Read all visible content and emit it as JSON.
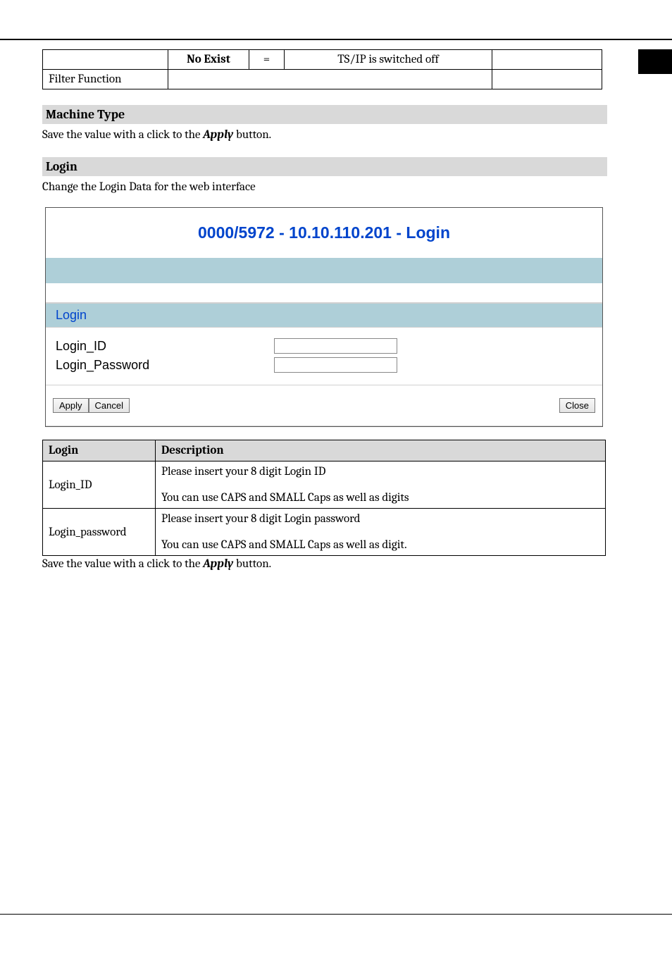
{
  "top_table": {
    "row1": {
      "c1": "",
      "c2": "No Exist",
      "c3": "=",
      "c4": "TS/IP is switched off",
      "c5": ""
    },
    "row2": {
      "c1": "Filter Function",
      "c2": "",
      "c3": "",
      "c4": "",
      "c5": ""
    }
  },
  "section_machine_type": {
    "heading": "Machine Type",
    "text_prefix": "Save the value with a click to the ",
    "text_bold": "Apply",
    "text_suffix": " button."
  },
  "section_login": {
    "heading": "Login",
    "text": "Change the Login Data for the web interface"
  },
  "login_panel": {
    "title": "0000/5972 - 10.10.110.201 - Login",
    "section_label": "Login",
    "field1_label": "Login_ID",
    "field1_value": "",
    "field2_label": "Login_Password",
    "field2_value": "",
    "buttons": {
      "apply": "Apply",
      "cancel": "Cancel",
      "close": "Close"
    }
  },
  "desc_table": {
    "header": {
      "c1": "Login",
      "c2": "Description"
    },
    "rows": [
      {
        "c1": "Login_ID",
        "c2_line1": "Please insert your 8 digit Login ID",
        "c2_line2": "You can use CAPS and SMALL Caps as well as digits"
      },
      {
        "c1": "Login_password",
        "c2_line1": "Please insert your 8 digit Login password",
        "c2_line2": "You can use CAPS and SMALL Caps as well as digit."
      }
    ]
  },
  "footer_text": {
    "prefix": "Save the value with a click to the ",
    "bold": "Apply",
    "suffix": " button."
  }
}
